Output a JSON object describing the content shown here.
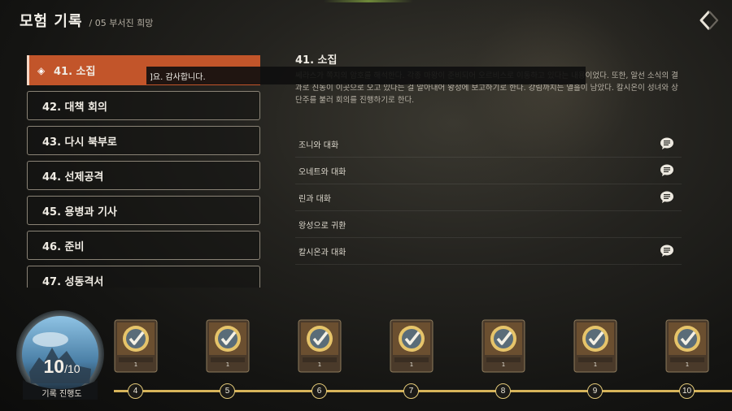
{
  "header": {
    "title": "모험 기록",
    "breadcrumb": "/ 05 부서진 희망"
  },
  "icons": {
    "back": "back-arrow-icon",
    "dialogue": "chat-bubble-icon",
    "reward": "check-badge-icon"
  },
  "colors": {
    "accent": "#c2552a",
    "gold": "#d7b45a"
  },
  "quest_list": {
    "items": [
      {
        "label": "41. 소집",
        "selected": true
      },
      {
        "label": "42. 대책 회의"
      },
      {
        "label": "43. 다시 북부로"
      },
      {
        "label": "44. 선제공격"
      },
      {
        "label": "45. 용병과 기사"
      },
      {
        "label": "46. 준비"
      },
      {
        "label": "47. 성동격서"
      }
    ]
  },
  "tooltip": {
    "text": "]요. 감사합니다."
  },
  "detail": {
    "title": "41. 소집",
    "description": "쎄라스가 쪽지의 암호를 해석한다. 각종 마왕이 준비되어 오르비스로 이동하고 있다는 내용이었다. 또한, 알선 소식의 결과로 진동이 이곳으로 오고 있다는 걸 알아내어 왕성에 보고하기로 한다. 강림까지는 열흘이 남았다. 칼시온이 성녀와 상단주를 불러 회의를 진행하기로 한다.",
    "steps": [
      {
        "label": "조니와 대화",
        "dialogue": true
      },
      {
        "label": "오네트와 대화",
        "dialogue": true
      },
      {
        "label": "린과 대화",
        "dialogue": true
      },
      {
        "label": "왕성으로 귀환",
        "dialogue": false
      },
      {
        "label": "칼시온과 대화",
        "dialogue": true
      }
    ]
  },
  "progress": {
    "current": "10",
    "total": "/10",
    "label": "기록 진행도"
  },
  "rewards": [
    {
      "count": "1",
      "node": "4"
    },
    {
      "count": "1",
      "node": "5"
    },
    {
      "count": "1",
      "node": "6"
    },
    {
      "count": "1",
      "node": "7"
    },
    {
      "count": "1",
      "node": "8"
    },
    {
      "count": "1",
      "node": "9"
    },
    {
      "count": "1",
      "node": "10"
    }
  ]
}
